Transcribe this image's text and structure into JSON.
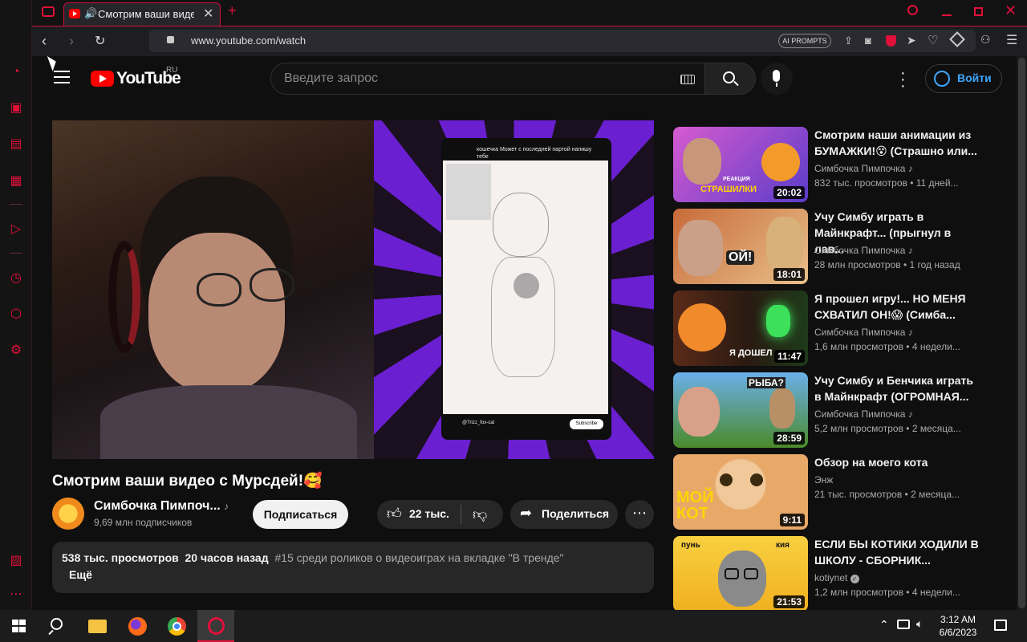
{
  "browser": {
    "tab_title": "Смотрим ваши видео с",
    "address": "www.youtube.com/watch",
    "ai_prompts": "AI PROMPTS",
    "accent": "#e0103a"
  },
  "youtube": {
    "logo_text": "YouTube",
    "region": "RU",
    "search_placeholder": "Введите запрос",
    "sign_in": "Войти",
    "video": {
      "title": "Смотрим ваши видео с Мурсдей!🥰",
      "overlay_caption": "кошечка Может с последней партой напишу тебе",
      "overlay_user": "@Trizz_fox-cat",
      "overlay_subscribe": "Subscribe"
    },
    "channel": {
      "name": "Симбочка Пимпоч...",
      "subscribers": "9,69 млн подписчиков",
      "subscribe": "Подписаться"
    },
    "actions": {
      "likes": "22 тыс.",
      "share": "Поделиться"
    },
    "description": {
      "views": "538 тыс. просмотров",
      "time": "20 часов назад",
      "trending": "#15 среди роликов о видеоиграх на вкладке \"В тренде\"",
      "more": "Ещё"
    },
    "related": [
      {
        "title": "Смотрим наши анимации из БУМАЖКИ!😵 (Страшно или...",
        "channel": "Симбочка Пимпочка ♪",
        "views": "832 тыс. просмотров",
        "age": "11 дней...",
        "duration": "20:02",
        "thumb_text": "СТРАШИЛКИ",
        "thumb_tag": "РЕАКЦИЯ"
      },
      {
        "title": "Учу Симбу играть в Майнкрафт... (прыгнул в лав...",
        "channel": "Симбочка Пимпочка ♪",
        "views": "28 млн просмотров",
        "age": "1 год назад",
        "duration": "18:01",
        "thumb_text": "ОЙ!"
      },
      {
        "title": "Я прошел игру!... НО МЕНЯ СХВАТИЛ ОН!😱 (Симба...",
        "channel": "Симбочка Пимпочка ♪",
        "views": "1,6 млн просмотров",
        "age": "4 недели...",
        "duration": "11:47",
        "thumb_text": "Я ДОШЕЛ"
      },
      {
        "title": "Учу Симбу и Бенчика играть в Майнкрафт (ОГРОМНАЯ...",
        "channel": "Симбочка Пимпочка ♪",
        "views": "5,2 млн просмотров",
        "age": "2 месяца...",
        "duration": "28:59",
        "thumb_text": "РЫБА?"
      },
      {
        "title": "Обзор на моего кота",
        "channel": "Энж",
        "views": "21 тыс. просмотров",
        "age": "2 месяца...",
        "duration": "9:11",
        "thumb_text": "МОЙ КОТ"
      },
      {
        "title": "ЕСЛИ БЫ КОТИКИ ХОДИЛИ В ШКОЛУ - СБОРНИК...",
        "channel": "kotiynet",
        "views": "1,2 млн просмотров",
        "age": "4 недели...",
        "duration": "21:53",
        "thumb_text_a": "пунь",
        "thumb_text_b": "кия"
      }
    ]
  },
  "taskbar": {
    "time": "3:12 AM",
    "date": "6/6/2023"
  }
}
